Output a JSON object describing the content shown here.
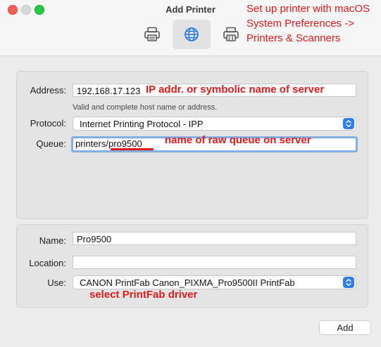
{
  "window": {
    "title": "Add Printer"
  },
  "toolbar": {
    "icons": [
      "printer-icon",
      "globe-icon",
      "fax-printer-icon"
    ],
    "active": "globe-icon"
  },
  "annotations": {
    "top_lines": [
      "Set up printer with macOS",
      "System  Preferences    ->",
      "Printers & Scanners"
    ],
    "address_note": "IP addr. or symbolic name of server",
    "queue_note": "name of raw queue on server",
    "driver_note": "select PrintFab driver",
    "color": "#e0191a"
  },
  "connection": {
    "address_label": "Address:",
    "address_value": "192.168.17.123",
    "address_hint": "Valid and complete host name or address.",
    "protocol_label": "Protocol:",
    "protocol_value": "Internet Printing Protocol - IPP",
    "queue_label": "Queue:",
    "queue_value": "printers/pro9500"
  },
  "details": {
    "name_label": "Name:",
    "name_value": "Pro9500",
    "location_label": "Location:",
    "location_value": "",
    "use_label": "Use:",
    "use_value": "CANON PrintFab Canon_PIXMA_Pro9500II PrintFab"
  },
  "buttons": {
    "add": "Add"
  },
  "colors": {
    "accent": "#2f7cf6",
    "focus_ring": "#82aee6"
  }
}
